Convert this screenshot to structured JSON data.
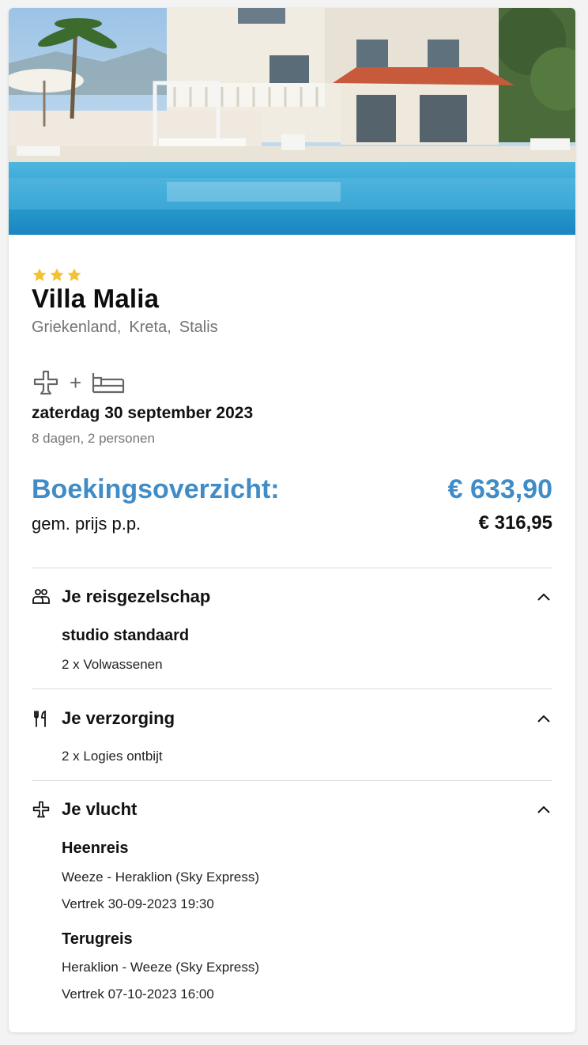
{
  "hotel": {
    "stars": 3,
    "name": "Villa Malia",
    "location": [
      "Griekenland,",
      "Kreta,",
      "Stalis"
    ]
  },
  "trip": {
    "icons": [
      "plane-icon",
      "plus",
      "bed-icon"
    ],
    "plus": "+",
    "date": "zaterdag 30 september 2023",
    "summary": "8 dagen, 2 personen"
  },
  "booking": {
    "title": "Boekingsoverzicht:",
    "total": "€ 633,90",
    "pp_label": "gem. prijs p.p.",
    "pp_value": "€ 316,95"
  },
  "sections": {
    "company": {
      "title": "Je reisgezelschap",
      "icon": "group-icon",
      "room": "studio standaard",
      "guests": "2 x Volwassenen"
    },
    "board": {
      "title": "Je verzorging",
      "icon": "cutlery-icon",
      "type": "2 x Logies ontbijt"
    },
    "flight": {
      "title": "Je vlucht",
      "icon": "plane-icon",
      "outbound_label": "Heenreis",
      "outbound_route": "Weeze - Heraklion (Sky Express)",
      "outbound_departure": "Vertrek 30-09-2023 19:30",
      "return_label": "Terugreis",
      "return_route": "Heraklion - Weeze (Sky Express)",
      "return_departure": "Vertrek 07-10-2023 16:00"
    }
  },
  "colors": {
    "accent": "#3f8cc7",
    "star": "#f2c230",
    "muted_text": "#737373",
    "divider": "#dcdcdc"
  }
}
